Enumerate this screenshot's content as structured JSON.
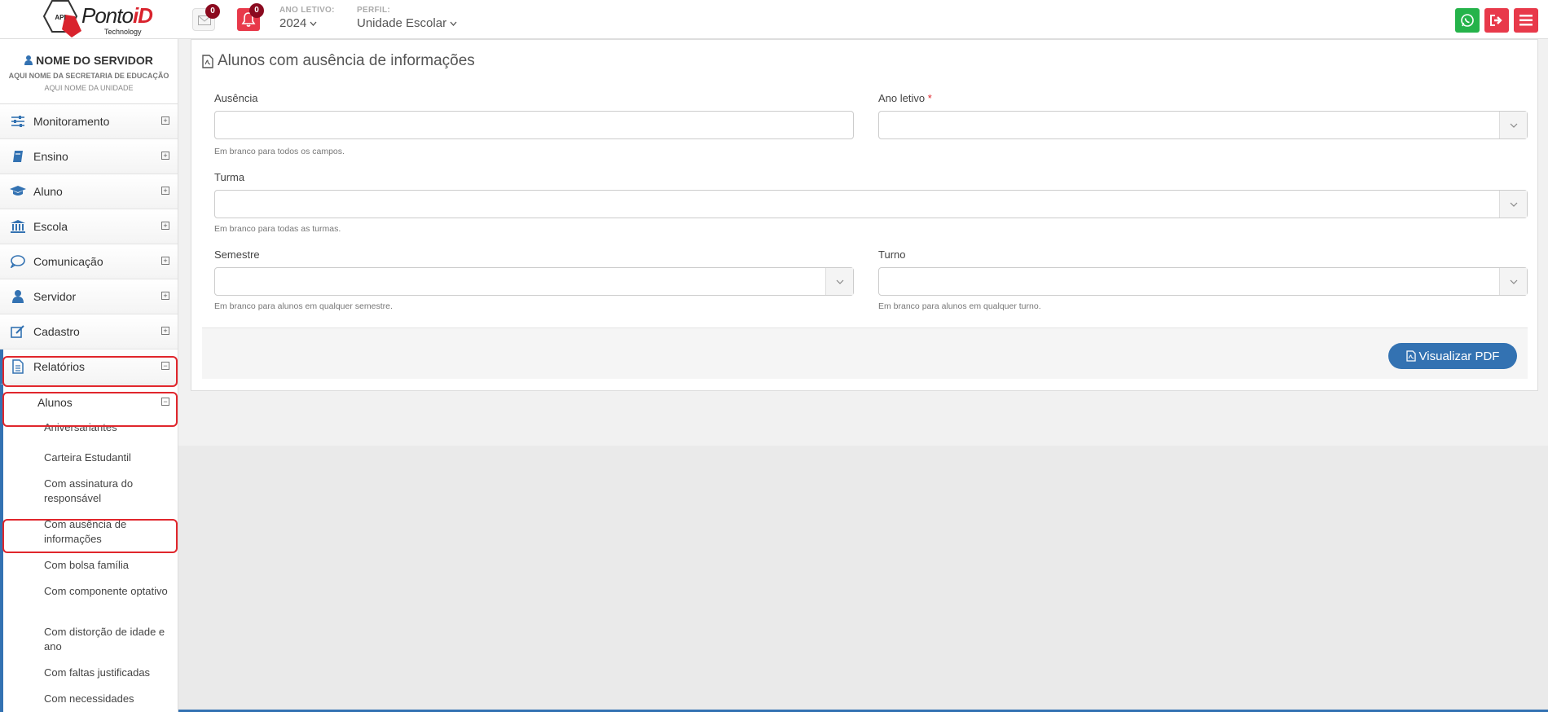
{
  "header": {
    "logo": {
      "brand_main": "Ponto",
      "brand_accent": "iD",
      "tagline": "Technology",
      "hex_text": "API"
    },
    "messages_count": "0",
    "notifications_count": "0",
    "school_year": {
      "label": "ANO LETIVO:",
      "value": "2024"
    },
    "profile": {
      "label": "PERFIL:",
      "value": "Unidade Escolar"
    },
    "actions": {
      "whatsapp_icon": "whatsapp-icon",
      "logout_icon": "logout-icon",
      "menu_icon": "hamburger-icon"
    }
  },
  "sidebar": {
    "user_name": "NOME DO SERVIDOR",
    "secretaria": "AQUI NOME DA SECRETARIA DE EDUCAÇÃO",
    "unidade": "AQUI NOME DA UNIDADE",
    "items": [
      {
        "label": "Monitoramento",
        "icon": "sliders-icon"
      },
      {
        "label": "Ensino",
        "icon": "book-icon"
      },
      {
        "label": "Aluno",
        "icon": "graduation-cap-icon"
      },
      {
        "label": "Escola",
        "icon": "institution-icon"
      },
      {
        "label": "Comunicação",
        "icon": "chat-bubble-icon"
      },
      {
        "label": "Servidor",
        "icon": "user-icon"
      },
      {
        "label": "Cadastro",
        "icon": "edit-icon"
      },
      {
        "label": "Relatórios",
        "icon": "report-file-icon"
      }
    ],
    "submenu_label": "Alunos",
    "submenu_items": [
      "Aniversariantes",
      "Carteira Estudantil",
      "Com assinatura do responsável",
      "Com ausência de informações",
      "Com bolsa família",
      "Com componente optativo",
      "Com distorção de idade e ano",
      "Com faltas justificadas",
      "Com necessidades"
    ]
  },
  "form": {
    "title": "Alunos com ausência de informações",
    "ausencia": {
      "label": "Ausência",
      "value": "",
      "help": "Em branco para todos os campos."
    },
    "ano_letivo": {
      "label": "Ano letivo",
      "required": "*",
      "value": ""
    },
    "turma": {
      "label": "Turma",
      "value": "",
      "help": "Em branco para todas as turmas."
    },
    "semestre": {
      "label": "Semestre",
      "value": "",
      "help": "Em branco para alunos em qualquer semestre."
    },
    "turno": {
      "label": "Turno",
      "value": "",
      "help": "Em branco para alunos em qualquer turno."
    },
    "submit_label": "Visualizar PDF"
  },
  "colors": {
    "primary": "#3372b2",
    "danger": "#e8394a",
    "whatsapp": "#25b34a",
    "badge": "#8b0a1f",
    "highlight": "#e0262c"
  }
}
